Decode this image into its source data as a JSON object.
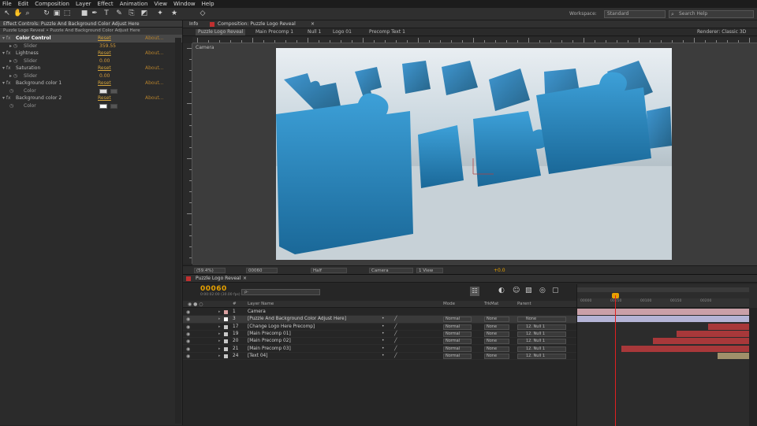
{
  "menu": [
    "File",
    "Edit",
    "Composition",
    "Layer",
    "Effect",
    "Animation",
    "View",
    "Window",
    "Help"
  ],
  "toolbar": {
    "workspace_label": "Workspace:",
    "workspace_value": "Standard",
    "search_placeholder": "Search Help"
  },
  "effect_controls": {
    "tab_title": "Effect Controls: Puzzle And Background Color Adjust Here",
    "header": "Puzzle Logo Reveal • Puzzle And Background Color Adjust Here",
    "rows": [
      {
        "type": "effect",
        "label": "Color Control",
        "reset": "Reset",
        "about": "About...",
        "selected": true
      },
      {
        "type": "sub",
        "label": "Slider",
        "value": "359.55"
      },
      {
        "type": "effect",
        "label": "Lightness",
        "reset": "Reset",
        "about": "About..."
      },
      {
        "type": "sub",
        "label": "Slider",
        "value": "0.00"
      },
      {
        "type": "effect",
        "label": "Saturation",
        "reset": "Reset",
        "about": "About..."
      },
      {
        "type": "sub",
        "label": "Slider",
        "value": "0.00"
      },
      {
        "type": "effect",
        "label": "Background color 1",
        "reset": "Reset",
        "about": "About..."
      },
      {
        "type": "color",
        "label": "Color",
        "color": "#e0e0e0"
      },
      {
        "type": "effect",
        "label": "Background color 2",
        "reset": "Reset",
        "about": "About..."
      },
      {
        "type": "color",
        "label": "Color",
        "color": "#ffffff"
      }
    ]
  },
  "composition": {
    "tabs": [
      "Info",
      "Composition: Puzzle Logo Reveal"
    ],
    "breadcrumbs": [
      "Puzzle Logo Reveal",
      "Main Precomp 1",
      "Null 1",
      "Logo 01",
      "Precomp Text 1"
    ],
    "renderer": "Renderer: Classic 3D",
    "view_label": "Camera",
    "controls": {
      "zoom": "(59.4%)",
      "timecode": "00060",
      "resolution": "Half",
      "view": "Camera",
      "views": "1 View",
      "exposure": "+0.0"
    }
  },
  "timeline": {
    "tab": "Puzzle Logo Reveal",
    "timecode": "00060",
    "timecode_sub": "0:00:02:00 (30.00 fps)",
    "search_placeholder": "ρ-",
    "columns": {
      "num": "#",
      "name": "Layer Name",
      "mode": "Mode",
      "trkmat": "TrkMat",
      "parent": "Parent"
    },
    "ruler_ticks": [
      "00000",
      "00050",
      "00100",
      "00150",
      "00200"
    ],
    "layers": [
      {
        "num": "1",
        "name": "Camera",
        "chip": "#d9a0a0",
        "mode": "",
        "trk": "",
        "parent": ""
      },
      {
        "num": "3",
        "name": "[Puzzle And Background Color Adjust Here]",
        "chip": "#ffffff",
        "mode": "Normal",
        "trk": "None",
        "parent": "None"
      },
      {
        "num": "17",
        "name": "[Change Logo Here Precomp]",
        "chip": "#c8c8c8",
        "mode": "Normal",
        "trk": "None",
        "parent": "12. Null 1"
      },
      {
        "num": "19",
        "name": "[Main Precomp 01]",
        "chip": "#c8c8c8",
        "mode": "Normal",
        "trk": "None",
        "parent": "12. Null 1"
      },
      {
        "num": "20",
        "name": "[Main Precomp 02]",
        "chip": "#c8c8c8",
        "mode": "Normal",
        "trk": "None",
        "parent": "12. Null 1"
      },
      {
        "num": "21",
        "name": "[Main Precomp 03]",
        "chip": "#c8c8c8",
        "mode": "Normal",
        "trk": "None",
        "parent": "12. Null 1"
      },
      {
        "num": "24",
        "name": "[Text 04]",
        "chip": "#c8c8c8",
        "mode": "Normal",
        "trk": "None",
        "parent": "12. Null 1"
      }
    ],
    "bar_colors": [
      "#caa0a8",
      "#b4b4d6",
      "#a8383a",
      "#a8383a",
      "#a8383a",
      "#a8383a",
      "#a0906a"
    ]
  }
}
